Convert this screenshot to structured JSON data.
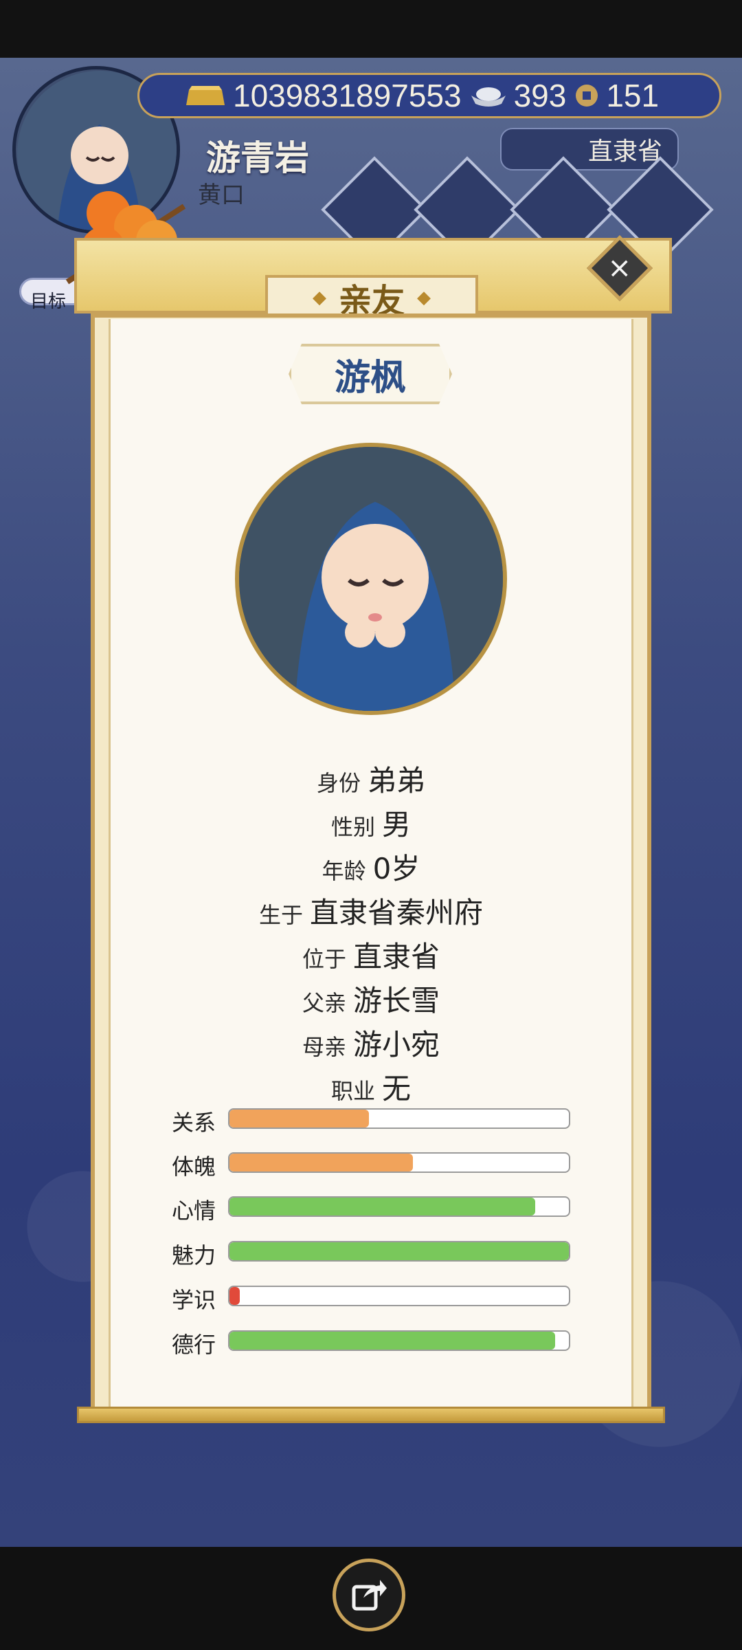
{
  "resources": {
    "gold": "1039831897553",
    "silver": "393",
    "coins": "151"
  },
  "player": {
    "name": "游青岩",
    "title": "黄口",
    "region": "直隶省",
    "goal_label": "目标"
  },
  "modal": {
    "title": "亲友",
    "person_name": "游枫",
    "info": [
      {
        "label": "身份",
        "value": "弟弟"
      },
      {
        "label": "性别",
        "value": "男"
      },
      {
        "label": "年龄",
        "value": "0岁"
      },
      {
        "label": "生于",
        "value": "直隶省秦州府"
      },
      {
        "label": "位于",
        "value": "直隶省"
      },
      {
        "label": "父亲",
        "value": "游长雪"
      },
      {
        "label": "母亲",
        "value": "游小宛"
      },
      {
        "label": "职业",
        "value": "无"
      }
    ],
    "stats": [
      {
        "label": "关系",
        "fill": 0.41,
        "color": "#f1a35b"
      },
      {
        "label": "体魄",
        "fill": 0.54,
        "color": "#f1a35b"
      },
      {
        "label": "心情",
        "fill": 0.9,
        "color": "#79c85b"
      },
      {
        "label": "魅力",
        "fill": 1.0,
        "color": "#79c85b"
      },
      {
        "label": "学识",
        "fill": 0.03,
        "color": "#e14a3a"
      },
      {
        "label": "德行",
        "fill": 0.96,
        "color": "#79c85b"
      }
    ]
  },
  "icons": {
    "gold": "gold-ingot-icon",
    "silver": "silver-ingot-icon",
    "coin": "copper-coin-icon",
    "close": "close-icon",
    "share": "share-icon"
  }
}
